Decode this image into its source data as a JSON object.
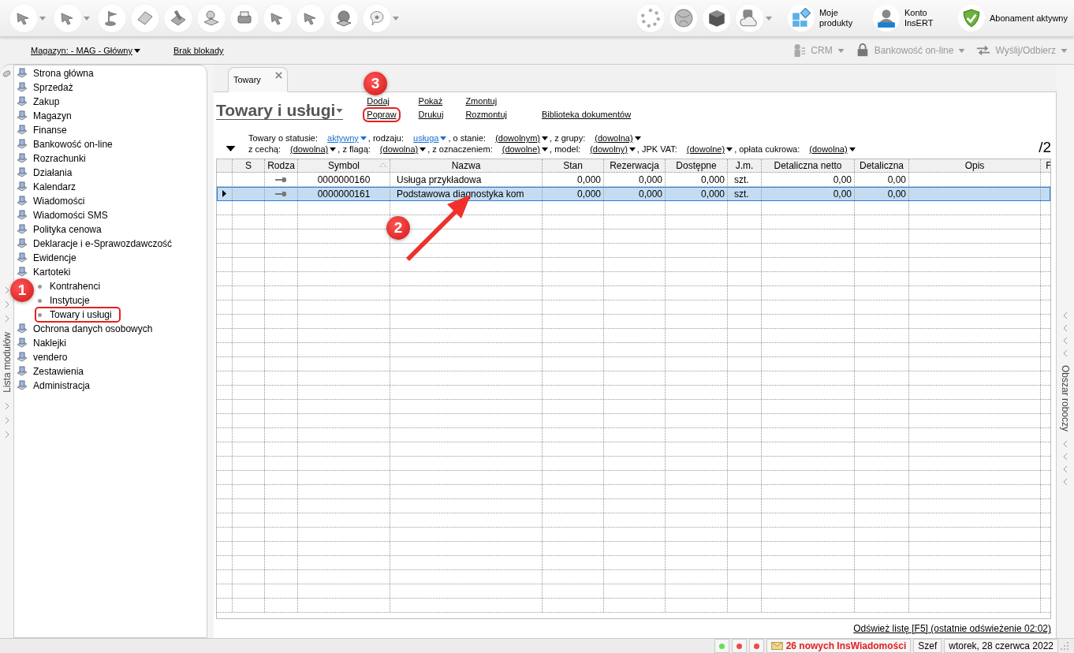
{
  "toolbar": {
    "right": [
      {
        "kind": "products",
        "label": "Moje produkty"
      },
      {
        "kind": "account",
        "label": "Konto InsERT"
      },
      {
        "kind": "subscription",
        "label": "Abonament aktywny"
      }
    ]
  },
  "subbar": {
    "warehouse": "Magazyn: - MAG - Główny",
    "lock": "Brak blokady",
    "menus": [
      "CRM",
      "Bankowość on-line",
      "Wyślij/Odbierz"
    ]
  },
  "left_strip": "Lista modułów",
  "right_strip": "Obszar roboczy",
  "sidebar": {
    "items": [
      {
        "label": "Strona główna"
      },
      {
        "label": "Sprzedaż"
      },
      {
        "label": "Zakup"
      },
      {
        "label": "Magazyn"
      },
      {
        "label": "Finanse"
      },
      {
        "label": "Bankowość on-line"
      },
      {
        "label": "Rozrachunki"
      },
      {
        "label": "Działania"
      },
      {
        "label": "Kalendarz"
      },
      {
        "label": "Wiadomości"
      },
      {
        "label": "Wiadomości SMS"
      },
      {
        "label": "Polityka cenowa"
      },
      {
        "label": "Deklaracje i e-Sprawozdawczość"
      },
      {
        "label": "Ewidencje"
      },
      {
        "label": "Kartoteki",
        "children": [
          {
            "label": "Kontrahenci",
            "highlighted": false
          },
          {
            "label": "Instytucje",
            "highlighted": false
          },
          {
            "label": "Towary i usługi",
            "highlighted": true
          }
        ]
      },
      {
        "label": "Ochrona danych osobowych"
      },
      {
        "label": "Naklejki"
      },
      {
        "label": "vendero"
      },
      {
        "label": "Zestawienia"
      },
      {
        "label": "Administracja"
      }
    ]
  },
  "tab": {
    "label": "Towary"
  },
  "title": "Towary i usługi",
  "action_groups": [
    {
      "links": [
        {
          "label": "Dodaj",
          "highlighted": false
        },
        {
          "label": "Popraw",
          "highlighted": true
        }
      ]
    },
    {
      "links": [
        {
          "label": "Pokaż",
          "highlighted": false
        },
        {
          "label": "Drukuj",
          "highlighted": false
        }
      ]
    },
    {
      "links": [
        {
          "label": "Zmontuj",
          "highlighted": false
        },
        {
          "label": "Rozmontuj",
          "highlighted": false
        }
      ]
    },
    {
      "links": [
        {
          "label": "Biblioteka dokumentów",
          "highlighted": false
        }
      ]
    }
  ],
  "filters": [
    [
      {
        "label": "Towary o statusie:",
        "value": "aktywny",
        "active": true
      },
      {
        "label": ", rodzaju:",
        "value": "usługa",
        "active": true
      },
      {
        "label": ", o stanie:",
        "value": "(dowolnym)",
        "active": false
      },
      {
        "label": ", z grupy:",
        "value": "(dowolna)",
        "active": false
      }
    ],
    [
      {
        "label": "z cechą:",
        "value": "(dowolna)",
        "active": false
      },
      {
        "label": ", z flagą:",
        "value": "(dowolna)",
        "active": false
      },
      {
        "label": ", z oznaczeniem:",
        "value": "(dowolne)",
        "active": false
      },
      {
        "label": ", model:",
        "value": "(dowolny)",
        "active": false
      },
      {
        "label": ", JPK VAT:",
        "value": "(dowolne)",
        "active": false
      },
      {
        "label": ", opłata cukrowa:",
        "value": "(dowolna)",
        "active": false
      }
    ]
  ],
  "page_indicator": "/2",
  "table": {
    "columns": [
      {
        "label": "S"
      },
      {
        "label": "Rodza"
      },
      {
        "label": "Symbol",
        "sorted": true
      },
      {
        "label": "Nazwa"
      },
      {
        "label": "Stan"
      },
      {
        "label": "Rezerwacja"
      },
      {
        "label": "Dostępne"
      },
      {
        "label": "J.m."
      },
      {
        "label": "Detaliczna netto"
      },
      {
        "label": "Detaliczna"
      },
      {
        "label": "Opis"
      },
      {
        "label": "F"
      }
    ],
    "rows": [
      {
        "selected": false,
        "kind": "service",
        "cells": [
          "",
          "",
          "0000000160",
          "Usługa przykładowa",
          "0,000",
          "0,000",
          "0,000",
          "szt.",
          "0,00",
          "0,00",
          "",
          ""
        ]
      },
      {
        "selected": true,
        "kind": "service",
        "cells": [
          "",
          "",
          "0000000161",
          "Podstawowa diagnostyka kom",
          "0,000",
          "0,000",
          "0,000",
          "szt.",
          "0,00",
          "0,00",
          "",
          ""
        ]
      }
    ]
  },
  "refresh": "Odśwież listę [F5] (ostatnie odświeżenie 02:02)",
  "status_bar": {
    "lights": [
      {
        "color": "#66dd55"
      },
      {
        "color": "#f04848"
      },
      {
        "color": "#f04848"
      }
    ],
    "messages": "26 nowych InsWiadomości",
    "user": "Szef",
    "date": "wtorek, 28 czerwca 2022"
  },
  "annotations": [
    {
      "kind": "badge",
      "label": "1"
    },
    {
      "kind": "arrow-badge",
      "label": "2"
    },
    {
      "kind": "badge",
      "label": "3"
    }
  ]
}
